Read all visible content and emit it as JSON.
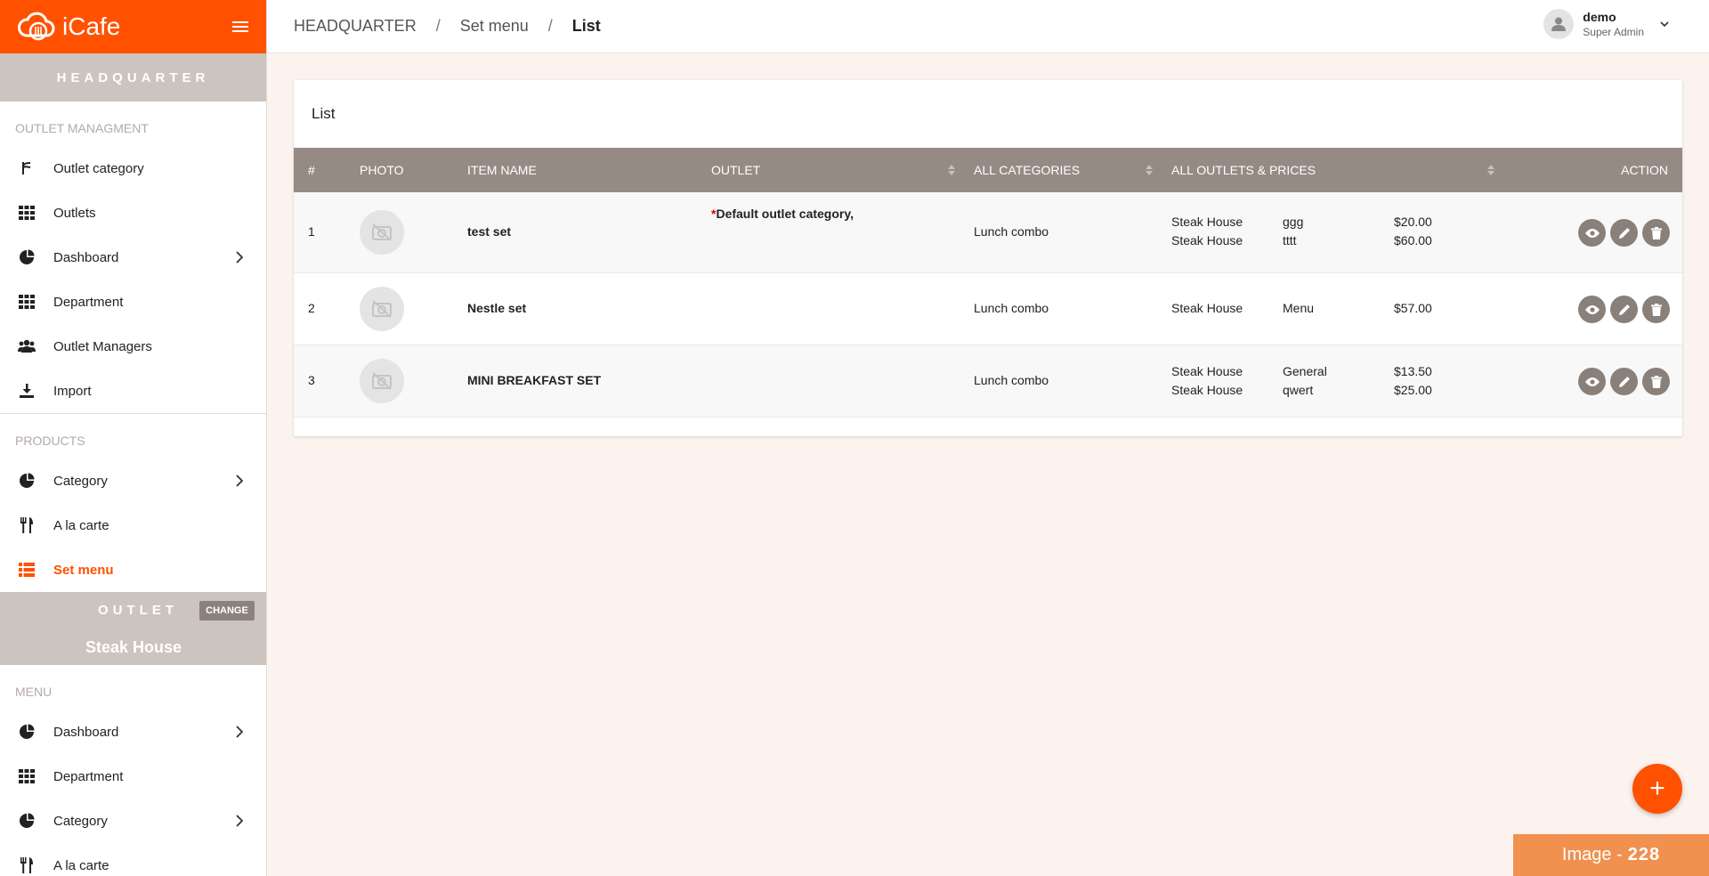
{
  "brand": {
    "name": "iCafe",
    "color": "#ff5100"
  },
  "sidebar": {
    "hq_label": "HEADQUARTER",
    "section_outlet": "OUTLET MANAGMENT",
    "outlet_items": [
      {
        "label": "Outlet category",
        "icon": "fork-icon"
      },
      {
        "label": "Outlets",
        "icon": "grid-icon"
      },
      {
        "label": "Dashboard",
        "icon": "pie-icon"
      },
      {
        "label": "Department",
        "icon": "grid-icon"
      },
      {
        "label": "Outlet Managers",
        "icon": "users-icon"
      },
      {
        "label": "Import",
        "icon": "download-icon"
      }
    ],
    "section_products": "PRODUCTS",
    "product_items": [
      {
        "label": "Category",
        "icon": "pie-icon"
      },
      {
        "label": "A la carte",
        "icon": "cutlery-icon"
      },
      {
        "label": "Set menu",
        "icon": "list-icon"
      }
    ],
    "outlet_band": {
      "label": "OUTLET",
      "change": "CHANGE",
      "name": "Steak House"
    },
    "section_menu": "MENU",
    "menu_items": [
      {
        "label": "Dashboard",
        "icon": "pie-icon"
      },
      {
        "label": "Department",
        "icon": "grid-icon"
      },
      {
        "label": "Category",
        "icon": "pie-icon"
      },
      {
        "label": "A la carte",
        "icon": "cutlery-icon"
      }
    ]
  },
  "header": {
    "breadcrumb": [
      "HEADQUARTER",
      "Set menu",
      "List"
    ],
    "separator": "/",
    "user": {
      "name": "demo",
      "role": "Super Admin"
    }
  },
  "card": {
    "title": "List",
    "columns": [
      "#",
      "PHOTO",
      "ITEM NAME",
      "OUTLET",
      "ALL CATEGORIES",
      "ALL OUTLETS & PRICES",
      "ACTION"
    ],
    "rows": [
      {
        "index": "1",
        "name": "test set",
        "outlet": "Default outlet category,",
        "outlet_marker": "*",
        "category": "Lunch combo",
        "prices": [
          {
            "outlet": "Steak House",
            "menu": "ggg",
            "price": "$20.00"
          },
          {
            "outlet": "Steak House",
            "menu": "tttt",
            "price": "$60.00"
          }
        ]
      },
      {
        "index": "2",
        "name": "Nestle set",
        "outlet": "",
        "outlet_marker": "",
        "category": "Lunch combo",
        "prices": [
          {
            "outlet": "Steak House",
            "menu": "Menu",
            "price": "$57.00"
          }
        ]
      },
      {
        "index": "3",
        "name": "MINI BREAKFAST SET",
        "outlet": "",
        "outlet_marker": "",
        "category": "Lunch combo",
        "prices": [
          {
            "outlet": "Steak House",
            "menu": "General",
            "price": "$13.50"
          },
          {
            "outlet": "Steak House",
            "menu": "qwert",
            "price": "$25.00"
          }
        ]
      }
    ]
  },
  "fab": {
    "label": "+"
  },
  "image_tag": {
    "prefix": "Image -",
    "number": "228"
  }
}
